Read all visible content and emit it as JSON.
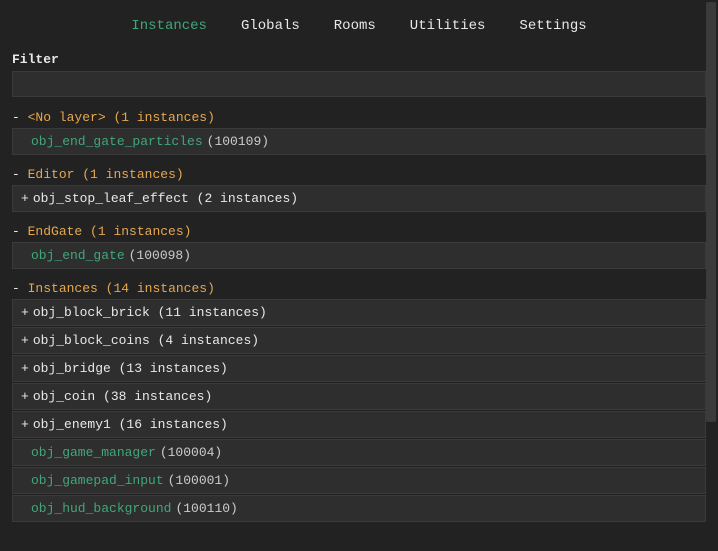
{
  "tabs": {
    "instances": "Instances",
    "globals": "Globals",
    "rooms": "Rooms",
    "utilities": "Utilities",
    "settings": "Settings"
  },
  "filter": {
    "label": "Filter",
    "value": ""
  },
  "layers": [
    {
      "toggle": "-",
      "name": "<No layer>",
      "count": "(1 instances)",
      "items": [
        {
          "type": "leaf",
          "name": "obj_end_gate_particles",
          "id": "(100109)"
        }
      ]
    },
    {
      "toggle": "-",
      "name": "Editor",
      "count": "(1 instances)",
      "items": [
        {
          "type": "group",
          "toggle": "+",
          "label": "obj_stop_leaf_effect (2 instances)"
        }
      ]
    },
    {
      "toggle": "-",
      "name": "EndGate",
      "count": "(1 instances)",
      "items": [
        {
          "type": "leaf",
          "name": "obj_end_gate",
          "id": "(100098)"
        }
      ]
    },
    {
      "toggle": "-",
      "name": "Instances",
      "count": "(14 instances)",
      "items": [
        {
          "type": "group",
          "toggle": "+",
          "label": "obj_block_brick (11 instances)"
        },
        {
          "type": "group",
          "toggle": "+",
          "label": "obj_block_coins (4 instances)"
        },
        {
          "type": "group",
          "toggle": "+",
          "label": "obj_bridge (13 instances)"
        },
        {
          "type": "group",
          "toggle": "+",
          "label": "obj_coin (38 instances)"
        },
        {
          "type": "group",
          "toggle": "+",
          "label": "obj_enemy1 (16 instances)"
        },
        {
          "type": "leaf",
          "name": "obj_game_manager",
          "id": "(100004)"
        },
        {
          "type": "leaf",
          "name": "obj_gamepad_input",
          "id": "(100001)"
        },
        {
          "type": "leaf",
          "name": "obj_hud_background",
          "id": "(100110)"
        }
      ]
    }
  ]
}
